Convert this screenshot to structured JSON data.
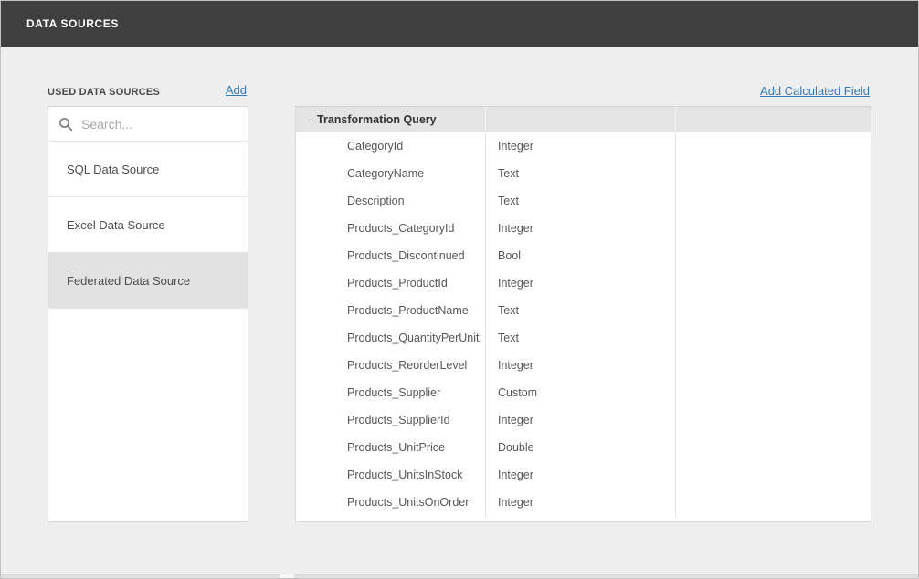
{
  "header": {
    "title": "DATA SOURCES"
  },
  "sidebar": {
    "section_label": "USED DATA SOURCES",
    "add_label": "Add",
    "search": {
      "placeholder": "Search...",
      "value": "",
      "icon": "search-icon"
    },
    "items": [
      {
        "label": "SQL Data Source",
        "selected": false
      },
      {
        "label": "Excel Data Source",
        "selected": false
      },
      {
        "label": "Federated Data Source",
        "selected": true
      }
    ]
  },
  "main": {
    "add_calculated_field_label": "Add Calculated Field",
    "table": {
      "collapse_glyph": "-",
      "group_label": "Transformation Query",
      "rows": [
        {
          "field": "CategoryId",
          "type": "Integer"
        },
        {
          "field": "CategoryName",
          "type": "Text"
        },
        {
          "field": "Description",
          "type": "Text"
        },
        {
          "field": "Products_CategoryId",
          "type": "Integer"
        },
        {
          "field": "Products_Discontinued",
          "type": "Bool"
        },
        {
          "field": "Products_ProductId",
          "type": "Integer"
        },
        {
          "field": "Products_ProductName",
          "type": "Text"
        },
        {
          "field": "Products_QuantityPerUnit",
          "type": "Text"
        },
        {
          "field": "Products_ReorderLevel",
          "type": "Integer"
        },
        {
          "field": "Products_Supplier",
          "type": "Custom"
        },
        {
          "field": "Products_SupplierId",
          "type": "Integer"
        },
        {
          "field": "Products_UnitPrice",
          "type": "Double"
        },
        {
          "field": "Products_UnitsInStock",
          "type": "Integer"
        },
        {
          "field": "Products_UnitsOnOrder",
          "type": "Integer"
        }
      ]
    }
  },
  "colors": {
    "header_bg": "#3f3f3f",
    "page_bg": "#eeeeee",
    "link_accent": "#337ab7",
    "selected_item_bg": "#e2e2e2",
    "table_header_bg": "#e4e4e4"
  }
}
